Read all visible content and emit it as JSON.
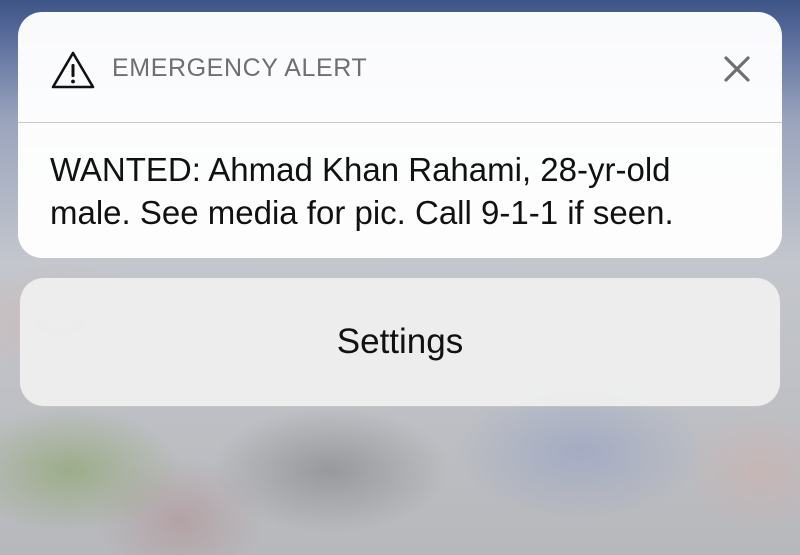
{
  "alert": {
    "app_name": "EMERGENCY ALERT",
    "icon": "warning-triangle-icon",
    "close_icon": "close-icon",
    "message": "WANTED: Ahmad Khan Rahami, 28-yr-old male. See media for pic. Call 9-1-1 if seen."
  },
  "actions": {
    "settings_label": "Settings"
  },
  "colors": {
    "card_background": "#ffffff",
    "header_text": "#6e6e73",
    "body_text": "#111111",
    "button_background": "#f0f0f0"
  }
}
